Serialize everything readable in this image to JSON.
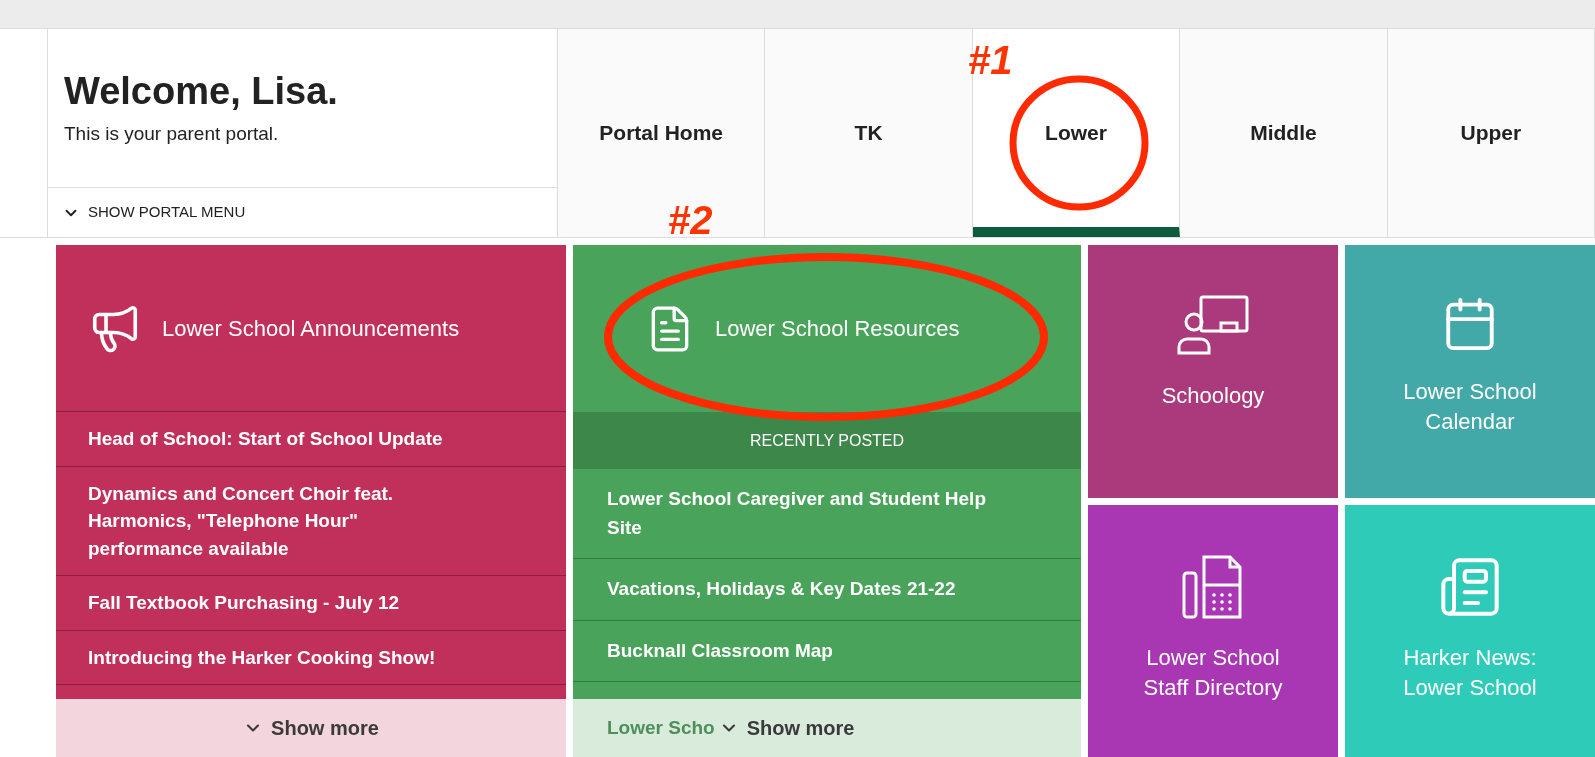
{
  "welcome": {
    "title": "Welcome, Lisa.",
    "subtitle": "This is your parent portal.",
    "menu_toggle": "SHOW PORTAL MENU"
  },
  "tabs": [
    {
      "label": "Portal Home",
      "selected": false
    },
    {
      "label": "TK",
      "selected": false
    },
    {
      "label": "Lower",
      "selected": true
    },
    {
      "label": "Middle",
      "selected": false
    },
    {
      "label": "Upper",
      "selected": false
    }
  ],
  "announcements": {
    "title": "Lower School Announcements",
    "items": [
      "Head of School: Start of School Update",
      "Dynamics and Concert Choir feat. Harmonics, \"Telephone Hour\" performance available",
      "Fall Textbook Purchasing - July 12",
      "Introducing the Harker Cooking Show!"
    ],
    "show_more": "Show more"
  },
  "resources": {
    "title": "Lower School Resources",
    "section": "RECENTLY POSTED",
    "items": [
      "Lower School Caregiver and Student Help Site",
      "Vacations, Holidays & Key Dates 21-22",
      "Bucknall Classroom Map"
    ],
    "faded_item": "Lower Scho",
    "show_more": "Show more"
  },
  "tiles": [
    {
      "kind": "presenter",
      "label": "Schoology",
      "color": "#ab3a7c"
    },
    {
      "kind": "calendar",
      "label": "Lower School Calendar",
      "color": "#42a8a8"
    },
    {
      "kind": "fax",
      "label": "Lower School Staff Directory",
      "color": "#a936b3"
    },
    {
      "kind": "newspaper",
      "label": "Harker News: Lower School",
      "color": "#2ecbb9"
    }
  ],
  "annotations": [
    {
      "label": "#1"
    },
    {
      "label": "#2"
    }
  ]
}
